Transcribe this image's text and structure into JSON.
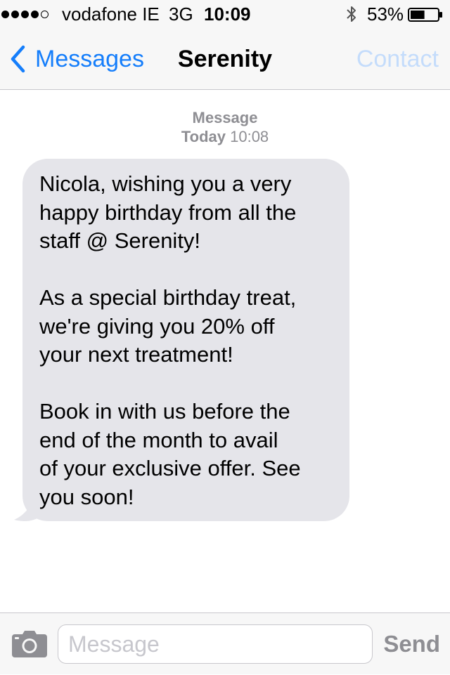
{
  "status_bar": {
    "signal_bars_filled": 4,
    "signal_bars_total": 5,
    "carrier": "vodafone IE",
    "network": "3G",
    "time": "10:09",
    "bluetooth_icon": "bluetooth-icon",
    "battery_percent": "53%",
    "battery_level": 0.53
  },
  "nav": {
    "back_label": "Messages",
    "back_icon": "chevron-left-icon",
    "title": "Serenity",
    "contact_label": "Contact"
  },
  "conversation": {
    "timestamp_label": "Message",
    "timestamp_day": "Today",
    "timestamp_time": "10:08",
    "messages": [
      {
        "direction": "incoming",
        "text": "Nicola, wishing you a very\nhappy birthday from all the\nstaff @ Serenity!\n\nAs a special birthday treat,\nwe're giving you 20% off\nyour next treatment!\n\nBook in with us before the\nend of the month to avail\nof your exclusive offer. See\nyou soon!"
      }
    ]
  },
  "input_bar": {
    "camera_icon": "camera-icon",
    "placeholder": "Message",
    "value": "",
    "send_label": "Send"
  },
  "colors": {
    "accent": "#157efb",
    "accent_disabled": "#c4dcfb",
    "bar_background": "#f7f7f7",
    "incoming_bubble": "#e5e5ea",
    "secondary_text": "#8e8e93",
    "separator": "#c8c7cc"
  }
}
